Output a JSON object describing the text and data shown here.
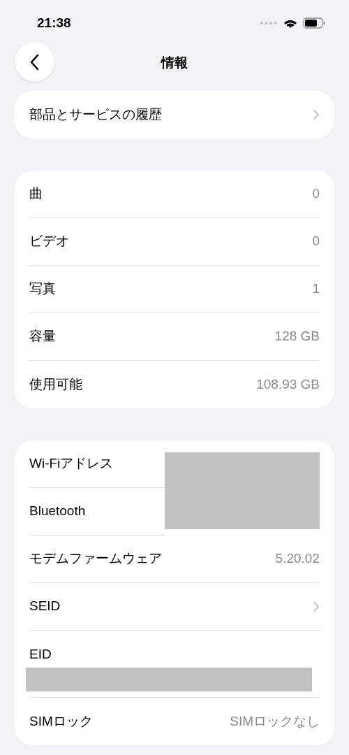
{
  "status_bar": {
    "time": "21:38"
  },
  "nav": {
    "title": "情報"
  },
  "sections": [
    {
      "rows": [
        {
          "label": "部品とサービスの履歴",
          "kind": "chevron"
        }
      ]
    },
    {
      "rows": [
        {
          "label": "曲",
          "kind": "value",
          "value": "0"
        },
        {
          "label": "ビデオ",
          "kind": "value",
          "value": "0"
        },
        {
          "label": "写真",
          "kind": "value",
          "value": "1"
        },
        {
          "label": "容量",
          "kind": "value",
          "value": "128 GB"
        },
        {
          "label": "使用可能",
          "kind": "value",
          "value": "108.93 GB"
        }
      ]
    },
    {
      "rows": [
        {
          "label": "Wi-Fiアドレス",
          "kind": "redacted"
        },
        {
          "label": "Bluetooth",
          "kind": "redacted"
        },
        {
          "label": "モデムファームウェア",
          "kind": "value",
          "value": "5.20.02"
        },
        {
          "label": "SEID",
          "kind": "chevron"
        },
        {
          "label": "EID",
          "kind": "redacted_below"
        },
        {
          "label": "SIMロック",
          "kind": "value",
          "value": "SIMロックなし"
        }
      ]
    }
  ]
}
